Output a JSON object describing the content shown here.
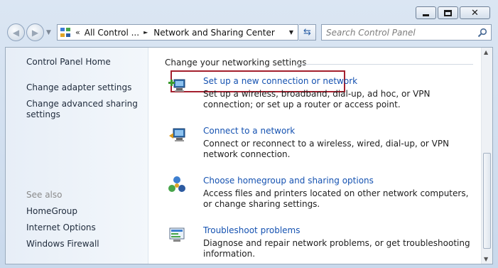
{
  "window_controls": {
    "minimize": "minimize",
    "maximize": "maximize",
    "close": "close"
  },
  "navigation": {
    "back_icon": "back-arrow-icon",
    "forward_icon": "forward-arrow-icon",
    "address": {
      "crumb_separator": "«",
      "breadcrumbs": [
        "All Control ...",
        "Network and Sharing Center"
      ],
      "arrow": "►"
    },
    "refresh_icon": "refresh-icon",
    "search": {
      "placeholder": "Search Control Panel",
      "icon": "search-icon"
    }
  },
  "sidebar": {
    "home": "Control Panel Home",
    "links": [
      "Change adapter settings",
      "Change advanced sharing settings"
    ],
    "see_also": {
      "heading": "See also",
      "items": [
        "HomeGroup",
        "Internet Options",
        "Windows Firewall"
      ]
    }
  },
  "main": {
    "section_title": "Change your networking settings",
    "tasks": [
      {
        "title": "Set up a new connection or network",
        "description": "Set up a wireless, broadband, dial-up, ad hoc, or VPN connection; or set up a router or access point.",
        "icon": "new-connection-icon",
        "highlighted": true
      },
      {
        "title": "Connect to a network",
        "description": "Connect or reconnect to a wireless, wired, dial-up, or VPN network connection.",
        "icon": "connect-network-icon"
      },
      {
        "title": "Choose homegroup and sharing options",
        "description": "Access files and printers located on other network computers, or change sharing settings.",
        "icon": "homegroup-icon"
      },
      {
        "title": "Troubleshoot problems",
        "description": "Diagnose and repair network problems, or get troubleshooting information.",
        "icon": "troubleshoot-icon"
      }
    ]
  },
  "colors": {
    "link": "#1552b1",
    "highlight_border": "#a4202e",
    "sidebar_bg": "#e7eef7"
  }
}
